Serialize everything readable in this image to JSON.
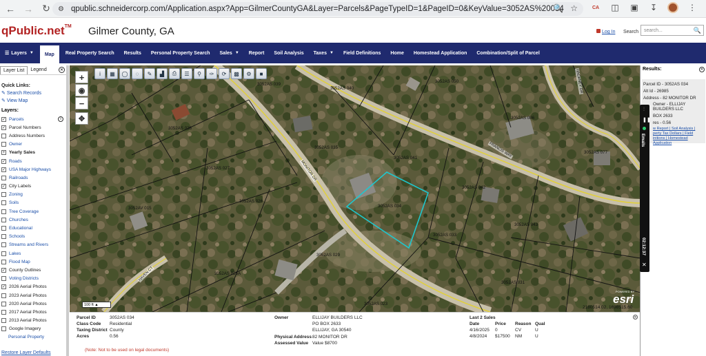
{
  "browser": {
    "url": "qpublic.schneidercorp.com/Application.aspx?App=GilmerCountyGA&Layer=Parcels&PageTypeID=1&PageID=0&KeyValue=3052AS%20034"
  },
  "header": {
    "logo": "qPublic.net",
    "logo_tm": "TM",
    "county": "Gilmer County, GA",
    "login": "Log In",
    "search_label": "Search",
    "search_placeholder": "search..."
  },
  "nav": [
    {
      "label": "Layers",
      "caret": true,
      "icon": "menu-icon"
    },
    {
      "label": "Map",
      "active": true
    },
    {
      "label": "Real Property Search"
    },
    {
      "label": "Results"
    },
    {
      "label": "Personal Property Search"
    },
    {
      "label": "Sales",
      "caret": true
    },
    {
      "label": "Report"
    },
    {
      "label": "Soil Analysis"
    },
    {
      "label": "Taxes",
      "caret": true
    },
    {
      "label": "Field Definitions"
    },
    {
      "label": "Home"
    },
    {
      "label": "Homestead Application"
    },
    {
      "label": "Combination/Split of Parcel"
    }
  ],
  "left_panel": {
    "tabs": [
      "Layer List",
      "Legend"
    ],
    "quick_links_title": "Quick Links:",
    "quick_links": [
      "Search Records",
      "View Map"
    ],
    "layers_title": "Layers:",
    "layers": [
      {
        "label": "Parcels",
        "checked": true,
        "link": true,
        "info": true
      },
      {
        "label": "Parcel Numbers",
        "checked": true,
        "link": false
      },
      {
        "label": "Address Numbers",
        "checked": false,
        "link": false
      },
      {
        "label": "Owner",
        "checked": false,
        "link": true
      },
      {
        "label": "Yearly Sales",
        "checked": false,
        "link": false,
        "group": true
      },
      {
        "label": "Roads",
        "checked": true,
        "link": true
      },
      {
        "label": "USA Major Highways",
        "checked": true,
        "link": true
      },
      {
        "label": "Railroads",
        "checked": false,
        "link": true
      },
      {
        "label": "City Labels",
        "checked": true,
        "link": false
      },
      {
        "label": "Zoning",
        "checked": false,
        "link": true
      },
      {
        "label": "Soils",
        "checked": false,
        "link": true
      },
      {
        "label": "Tree Coverage",
        "checked": false,
        "link": true
      },
      {
        "label": "Churches",
        "checked": false,
        "link": true
      },
      {
        "label": "Educational",
        "checked": false,
        "link": true
      },
      {
        "label": "Schools",
        "checked": false,
        "link": true
      },
      {
        "label": "Streams and Rivers",
        "checked": false,
        "link": true
      },
      {
        "label": "Lakes",
        "checked": false,
        "link": true
      },
      {
        "label": "Flood Map",
        "checked": false,
        "link": true
      },
      {
        "label": "County Outlines",
        "checked": true,
        "link": false
      },
      {
        "label": "Voting Districts",
        "checked": false,
        "link": true
      },
      {
        "label": "2026 Aerial Photos",
        "checked": true,
        "link": false
      },
      {
        "label": "2023 Aerial Photos",
        "checked": false,
        "link": false
      },
      {
        "label": "2020 Aerial Photos",
        "checked": false,
        "link": false
      },
      {
        "label": "2017 Aerial Photos",
        "checked": false,
        "link": false
      },
      {
        "label": "2013 Aerial Photos",
        "checked": false,
        "link": false
      },
      {
        "label": "Google Imagery",
        "checked": false,
        "link": false
      },
      {
        "label": "Personal Property",
        "checked": null,
        "link": true
      }
    ],
    "restore": "Restore Layer Defaults"
  },
  "map": {
    "scale": "100 ft",
    "coords": "2180514.02, 1698515.60",
    "esri": "esri",
    "esri_powered": "POWERED BY",
    "parcels": [
      {
        "label": "3052AS 040"
      },
      {
        "label": "3052AS 039"
      },
      {
        "label": "3052AS 050"
      },
      {
        "label": "3052AS 028"
      },
      {
        "label": "3052AS 086"
      },
      {
        "label": "3052AS 035"
      },
      {
        "label": "3052AS 041"
      },
      {
        "label": "3052AS 077"
      },
      {
        "label": "3052AS 027"
      },
      {
        "label": "3052AS 042"
      },
      {
        "label": "3052AS 026"
      },
      {
        "label": "3052AS 034"
      },
      {
        "label": "3052AV 015"
      },
      {
        "label": "3052AS 043"
      },
      {
        "label": "3052AS 033"
      },
      {
        "label": "3052AS 029"
      },
      {
        "label": "3052AS 025A"
      },
      {
        "label": "3052AS 031"
      },
      {
        "label": "3052AS 023"
      }
    ],
    "roads": [
      "MONITOR DR",
      "FRANCIS WAY",
      "HAVEN CT",
      "HACKNEY DR"
    ]
  },
  "results": {
    "title": "Results:",
    "parcel_id": "Parcel ID - 3052AS 034",
    "alt_id": "Alt Id - 26985",
    "address": "Address - 82 MONITOR DR",
    "owner": "Owner - ELLIJAY BUILDERS LLC",
    "po_box": "BOX 2633",
    "acres": "res - 0.56",
    "links": "w Report | Soil Analysis | perty Tax Dollars | Field initions | Homestead Application"
  },
  "timer": {
    "label": "Emails",
    "time": "02:12:37"
  },
  "bottom": {
    "parcel_id_lbl": "Parcel ID",
    "parcel_id": "3052AS 034",
    "class_lbl": "Class Code",
    "class": "Residential",
    "taxing_lbl": "Taxing District",
    "taxing": "County",
    "acres_lbl": "Acres",
    "acres": "0.56",
    "owner_lbl": "Owner",
    "owner_lines": [
      "ELLIJAY BUILDERS LLC",
      "PO BOX 2633",
      "ELLIJAY, GA 30540"
    ],
    "phys_lbl": "Physical Address",
    "phys": "82 MONITOR DR",
    "assessed_lbl": "Assessed Value",
    "assessed": "Value $8700",
    "sales_title": "Last 2 Sales",
    "sales_headers": [
      "Date",
      "Price",
      "Reason",
      "Qual"
    ],
    "sales": [
      [
        "4/16/2025",
        "0",
        "CV",
        "U"
      ],
      [
        "4/8/2024",
        "$17500",
        "NM",
        "U"
      ]
    ],
    "note": "(Note: Not to be used on legal documents)"
  }
}
